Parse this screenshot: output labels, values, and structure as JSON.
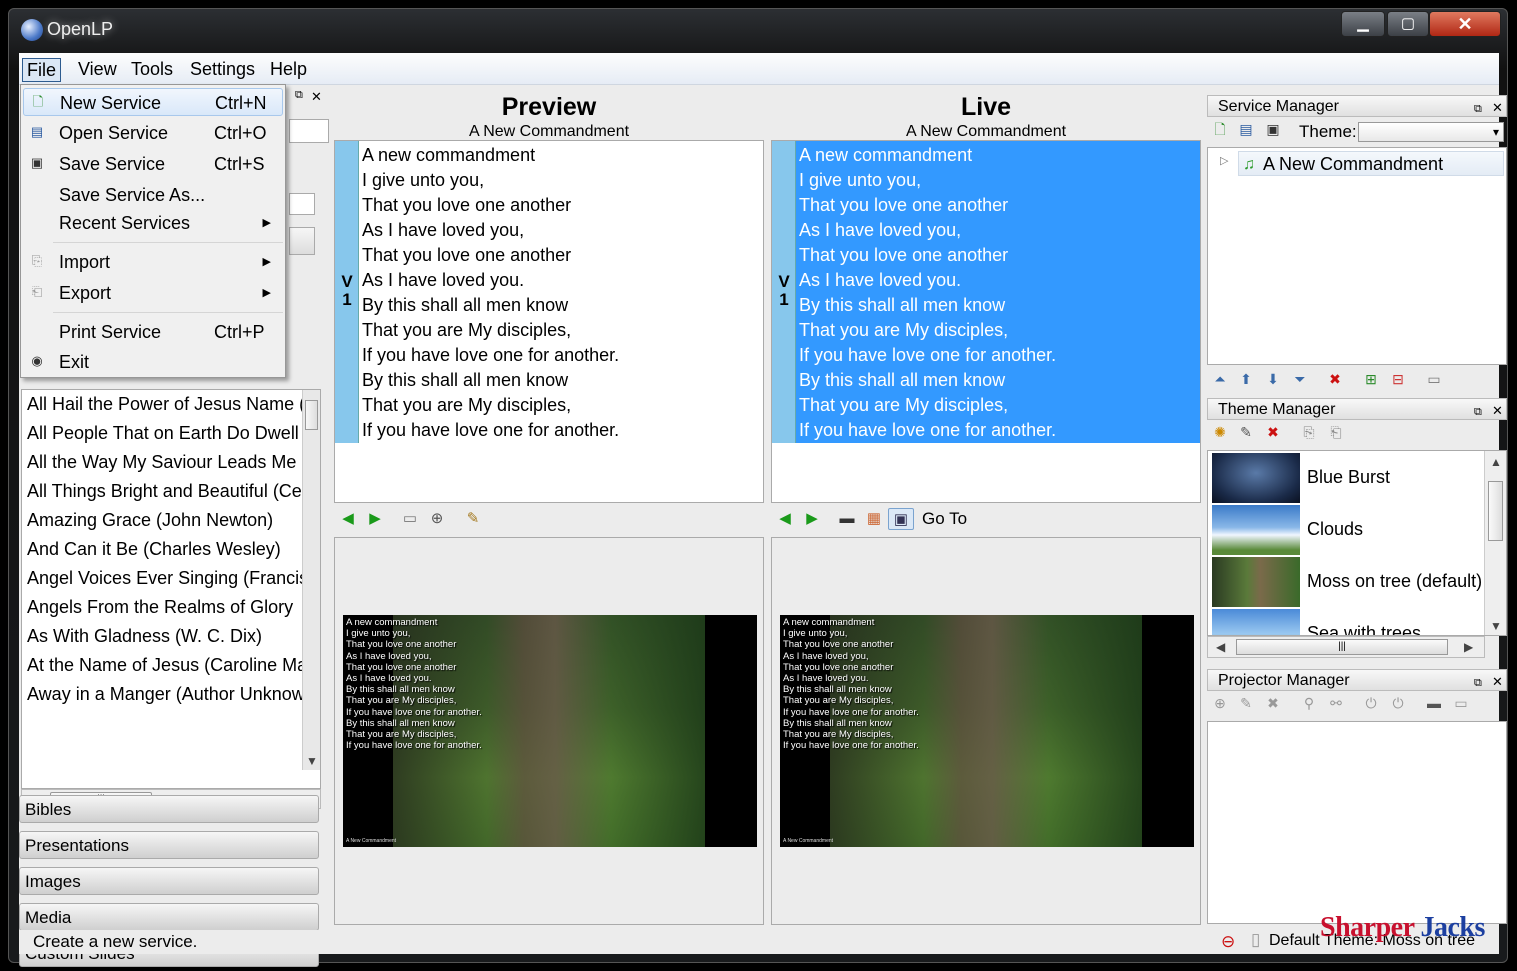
{
  "window": {
    "title": "OpenLP"
  },
  "menubar": [
    "File",
    "View",
    "Tools",
    "Settings",
    "Help"
  ],
  "file_menu": [
    {
      "label": "New Service",
      "shortcut": "Ctrl+N",
      "icon": "new-service-icon"
    },
    {
      "label": "Open Service",
      "shortcut": "Ctrl+O",
      "icon": "open-icon"
    },
    {
      "label": "Save Service",
      "shortcut": "Ctrl+S",
      "icon": "save-icon"
    },
    {
      "label": "Save Service As...",
      "shortcut": ""
    },
    {
      "label": "Recent Services",
      "shortcut": "",
      "submenu": true
    },
    {
      "label": "Import",
      "shortcut": "",
      "submenu": true,
      "icon": "import-icon"
    },
    {
      "label": "Export",
      "shortcut": "",
      "submenu": true,
      "icon": "export-icon"
    },
    {
      "label": "Print Service",
      "shortcut": "Ctrl+P"
    },
    {
      "label": "Exit",
      "shortcut": "",
      "icon": "exit-icon"
    }
  ],
  "songs": [
    "All Hail the Power of Jesus Name (",
    "All People That on Earth Do Dwell",
    "All the Way My Saviour Leads Me",
    "All Things Bright and Beautiful (Ce",
    "Amazing Grace (John Newton)",
    "And Can it Be (Charles Wesley)",
    "Angel Voices Ever Singing (Francis",
    "Angels From the Realms of Glory",
    "As With Gladness (W. C. Dix)",
    "At the Name of Jesus (Caroline Ma",
    "Away in a Manger (Author Unknow"
  ],
  "sections": [
    "Bibles",
    "Presentations",
    "Images",
    "Media",
    "Custom Slides"
  ],
  "preview": {
    "heading": "Preview",
    "subtitle": "A New Commandment"
  },
  "live": {
    "heading": "Live",
    "subtitle": "A New Commandment",
    "goto_label": "Go To"
  },
  "verse_tag": {
    "letter": "V",
    "number": "1"
  },
  "verse_lines": [
    "A new commandment",
    "I give unto you,",
    "That you love one another",
    "As I have loved you,",
    "That you love one another",
    "As I have loved you.",
    "By this shall all men know",
    "That you are My disciples,",
    "If you have love one for another.",
    "By this shall all men know",
    "That you are My disciples,",
    "If you have love one for another."
  ],
  "service_manager": {
    "title": "Service Manager",
    "theme_label": "Theme:",
    "items": [
      "A New Commandment"
    ]
  },
  "theme_manager": {
    "title": "Theme Manager",
    "themes": [
      "Blue Burst",
      "Clouds",
      "Moss on tree (default)",
      "Sea with trees"
    ]
  },
  "projector_manager": {
    "title": "Projector Manager"
  },
  "status": {
    "message": "Create a new service.",
    "right": "Default Theme: Moss on tree"
  },
  "watermark": {
    "part1": "Sharper",
    "part2": "Jacks"
  }
}
